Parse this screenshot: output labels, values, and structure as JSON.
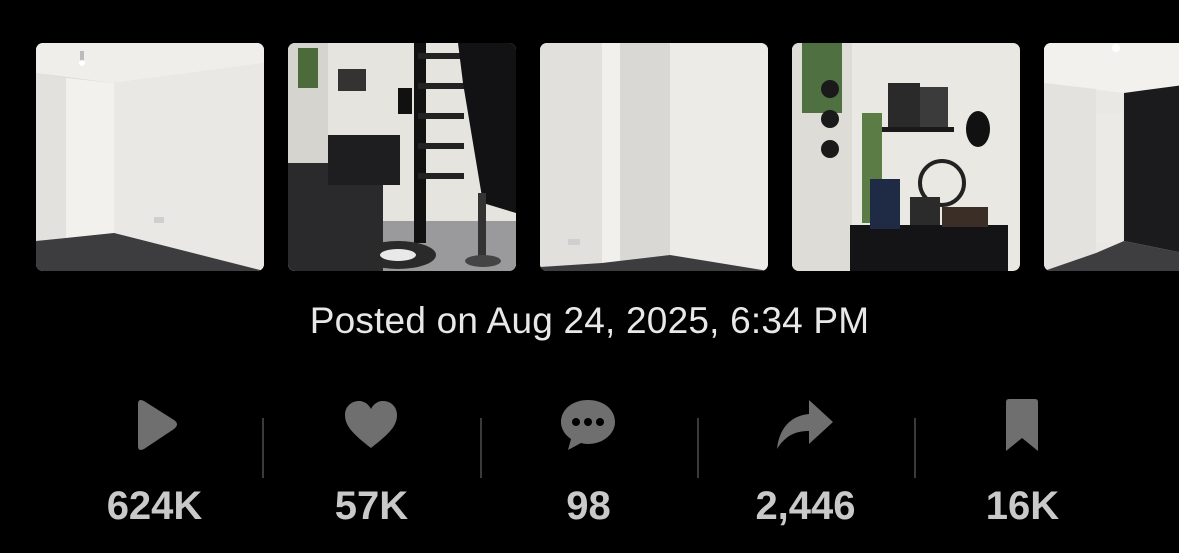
{
  "post": {
    "posted_text": "Posted on Aug 24, 2025, 6:34 PM"
  },
  "thumbnails": [
    {
      "icon": "empty-room-photo"
    },
    {
      "icon": "furnished-bedroom-photo"
    },
    {
      "icon": "empty-corner-photo"
    },
    {
      "icon": "desk-decor-photo"
    },
    {
      "icon": "hallway-dark-wall-photo"
    }
  ],
  "stats": {
    "views": {
      "icon": "play-icon",
      "count": "624K"
    },
    "likes": {
      "icon": "heart-icon",
      "count": "57K"
    },
    "comments": {
      "icon": "comment-icon",
      "count": "98"
    },
    "shares": {
      "icon": "share-icon",
      "count": "2,446"
    },
    "saves": {
      "icon": "bookmark-icon",
      "count": "16K"
    }
  },
  "colors": {
    "background": "#000000",
    "icon": "#6f6f6f",
    "count_text": "#c9c9c9",
    "posted_text": "#e8e8e8"
  }
}
